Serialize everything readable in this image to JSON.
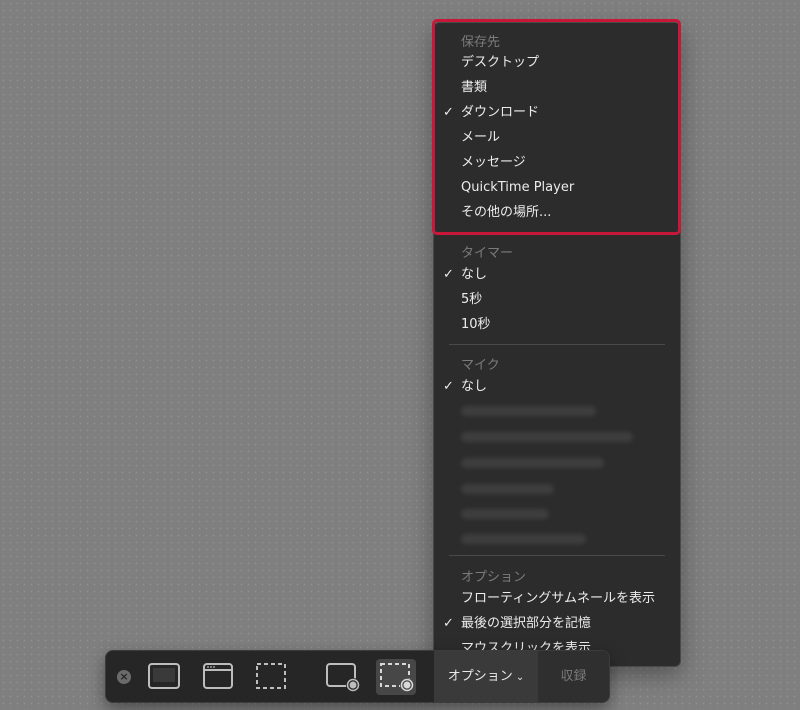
{
  "menu": {
    "save_section": {
      "header": "保存先",
      "items": [
        {
          "label": "デスクトップ",
          "checked": false
        },
        {
          "label": "書類",
          "checked": false
        },
        {
          "label": "ダウンロード",
          "checked": true
        },
        {
          "label": "メール",
          "checked": false
        },
        {
          "label": "メッセージ",
          "checked": false
        },
        {
          "label": "QuickTime Player",
          "checked": false
        },
        {
          "label": "その他の場所...",
          "checked": false
        }
      ]
    },
    "timer_section": {
      "header": "タイマー",
      "items": [
        {
          "label": "なし",
          "checked": true
        },
        {
          "label": "5秒",
          "checked": false
        },
        {
          "label": "10秒",
          "checked": false
        }
      ]
    },
    "mic_section": {
      "header": "マイク",
      "items": [
        {
          "label": "なし",
          "checked": true
        }
      ]
    },
    "options_section": {
      "header": "オプション",
      "items": [
        {
          "label": "フローティングサムネールを表示",
          "checked": false
        },
        {
          "label": "最後の選択部分を記憶",
          "checked": true
        },
        {
          "label": "マウスクリックを表示",
          "checked": false
        }
      ]
    },
    "check_glyph": "✓",
    "highlight_color": "#c8183a"
  },
  "toolbar": {
    "close_glyph": "×",
    "options_label": "オプション",
    "options_chevron": "⌄",
    "record_label": "収録"
  }
}
